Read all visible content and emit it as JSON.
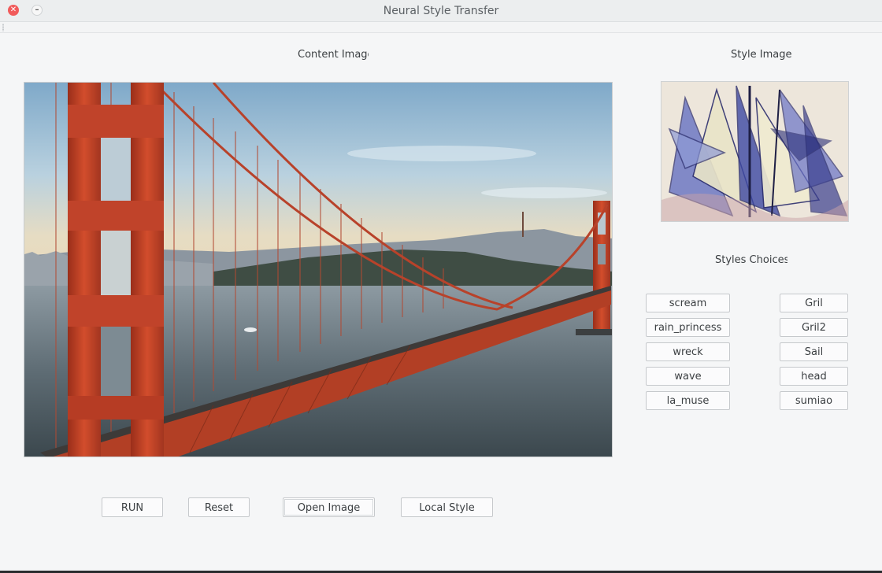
{
  "window": {
    "title": "Neural Style Transfer"
  },
  "labels": {
    "content_image": "Content Image",
    "style_image": "Style Image",
    "styles_choices": "Styles Choices"
  },
  "style_choices": {
    "left": [
      "scream",
      "rain_princess",
      "wreck",
      "wave",
      "la_muse"
    ],
    "right": [
      "Gril",
      "Gril2",
      "Sail",
      "head",
      "sumiao"
    ]
  },
  "actions": {
    "run": "RUN",
    "reset": "Reset",
    "open_image": "Open Image",
    "local_style": "Local Style"
  },
  "colors": {
    "window_bg": "#f5f6f7",
    "close_button": "#f15b5b",
    "bridge": "#c8452a"
  },
  "icons": {
    "close": "close-icon",
    "minimize": "minimize-icon"
  }
}
